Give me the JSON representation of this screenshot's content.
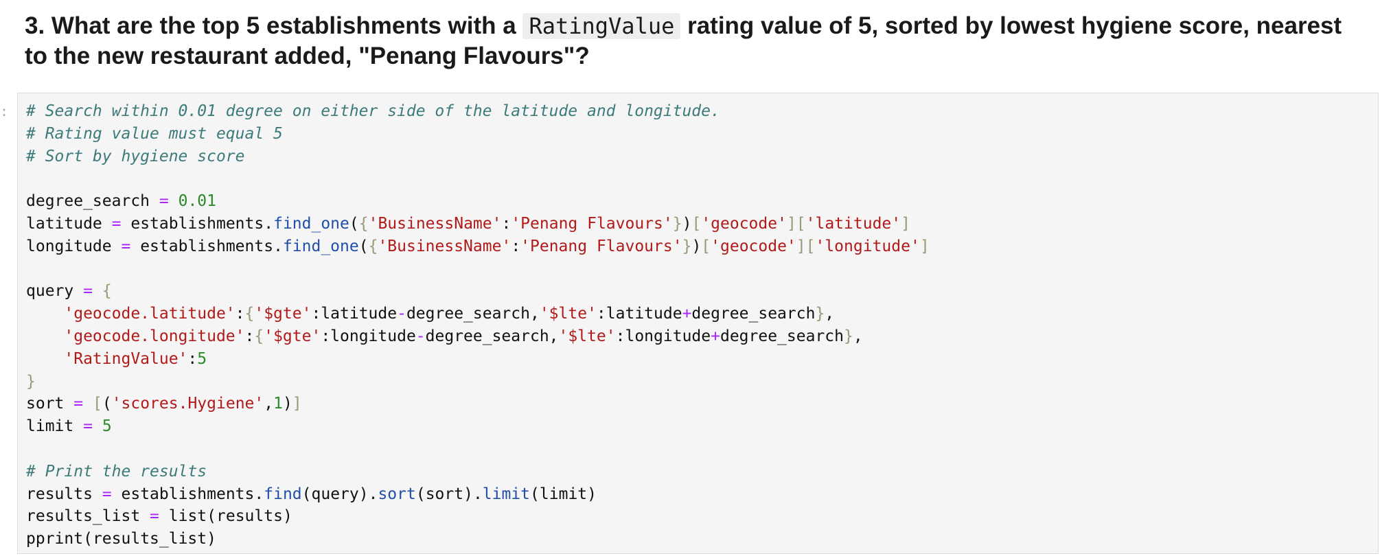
{
  "markdown": {
    "heading_before_code": "3. What are the top 5 establishments with a ",
    "inline_code": "RatingValue",
    "heading_after_code": " rating value of 5, sorted by lowest hygiene score, nearest to the new restaurant added, \"Penang Flavours\"?"
  },
  "cell": {
    "prompt": ":"
  },
  "code": {
    "comment_1": "# Search within 0.01 degree on either side of the latitude and longitude.",
    "comment_2": "# Rating value must equal 5",
    "comment_3": "# Sort by hygiene score",
    "degree_var": "degree_search",
    "degree_val": "0.01",
    "lat_var": "latitude",
    "lon_var": "longitude",
    "coll": "establishments",
    "find_one": "find_one",
    "key_business": "'BusinessName'",
    "val_penang": "'Penang Flavours'",
    "key_geocode": "'geocode'",
    "key_latitude": "'latitude'",
    "key_longitude": "'longitude'",
    "query_var": "query",
    "key_geo_lat": "'geocode.latitude'",
    "key_geo_lon": "'geocode.longitude'",
    "key_gte": "'$gte'",
    "key_lte": "'$lte'",
    "key_rating": "'RatingValue'",
    "rating_num": "5",
    "sort_var": "sort",
    "key_scores_hygiene": "'scores.Hygiene'",
    "sort_dir": "1",
    "limit_var": "limit",
    "limit_val": "5",
    "comment_print": "# Print the results",
    "results_var": "results",
    "find": "find",
    "sort_fn": "sort",
    "limit_fn": "limit",
    "results_list_var": "results_list",
    "list_fn": "list",
    "pprint_fn": "pprint"
  }
}
